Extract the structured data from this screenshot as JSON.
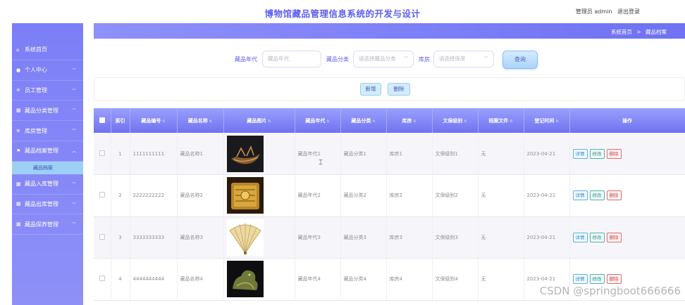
{
  "header": {
    "title": "博物馆藏品管理信息系统的开发与设计",
    "user_label": "管理员 admin",
    "logout": "退出登录"
  },
  "sidebar": {
    "items": [
      {
        "icon": "home-icon",
        "label": "系统首页",
        "chevron": false
      },
      {
        "icon": "user-icon",
        "label": "个人中心",
        "chevron": true
      },
      {
        "icon": "list-icon",
        "label": "员工管理",
        "chevron": true
      },
      {
        "icon": "grid-icon",
        "label": "藏品分类管理",
        "chevron": true
      },
      {
        "icon": "list-icon",
        "label": "库房管理",
        "chevron": true
      },
      {
        "icon": "flag-icon",
        "label": "藏品档案管理",
        "chevron": true,
        "expanded": true
      },
      {
        "icon": "grid-icon",
        "label": "藏品入库管理",
        "chevron": true
      },
      {
        "icon": "grid-icon",
        "label": "藏品出库管理",
        "chevron": true
      },
      {
        "icon": "grid-icon",
        "label": "藏品保养管理",
        "chevron": true
      }
    ],
    "active_sub": "藏品档案"
  },
  "breadcrumb": {
    "home": "系统首页",
    "separator": ">",
    "current": "藏品档案"
  },
  "search": {
    "year_label": "藏品年代",
    "year_placeholder": "藏品年代",
    "category_label": "藏品分类",
    "category_placeholder": "请选择藏品分类",
    "warehouse_label": "库房",
    "warehouse_placeholder": "请选择库房",
    "button": "查询"
  },
  "actions": {
    "add": "新增",
    "delete": "删除"
  },
  "table": {
    "headers": [
      "",
      "索引",
      "藏品编号",
      "藏品名称",
      "藏品图片",
      "藏品年代",
      "藏品分类",
      "库房",
      "文保级别",
      "档案文件",
      "登记时间",
      "操作"
    ],
    "rows": [
      {
        "index": "1",
        "code": "1111111111",
        "name": "藏品名称1",
        "image": "boat",
        "year": "藏品年代1",
        "category": "藏品分类1",
        "warehouse": "库房1",
        "level": "文保级别1",
        "file": "无",
        "date": "2023-04-21"
      },
      {
        "index": "2",
        "code": "2222222222",
        "name": "藏品名称2",
        "image": "bronze",
        "year": "藏品年代2",
        "category": "藏品分类2",
        "warehouse": "库房2",
        "level": "文保级别2",
        "file": "无",
        "date": "2023-04-21"
      },
      {
        "index": "3",
        "code": "3333333333",
        "name": "藏品名称3",
        "image": "fan",
        "year": "藏品年代3",
        "category": "藏品分类3",
        "warehouse": "库房3",
        "level": "文保级别3",
        "file": "无",
        "date": "2023-04-21"
      },
      {
        "index": "4",
        "code": "4444444444",
        "name": "藏品名称4",
        "image": "beast",
        "year": "藏品年代4",
        "category": "藏品分类4",
        "warehouse": "库房4",
        "level": "文保级别4",
        "file": "无",
        "date": "2023-04-21"
      }
    ],
    "row_actions": {
      "detail": "详情",
      "edit": "修改",
      "delete": "删除"
    }
  },
  "watermark": "CSDN @springboot666666",
  "colors": {
    "accent": "#6f72f2",
    "title": "#5c5ff0",
    "sidebar": "#7c7ef7",
    "submenu": "#9ed0f5",
    "delete": "#d04545"
  }
}
